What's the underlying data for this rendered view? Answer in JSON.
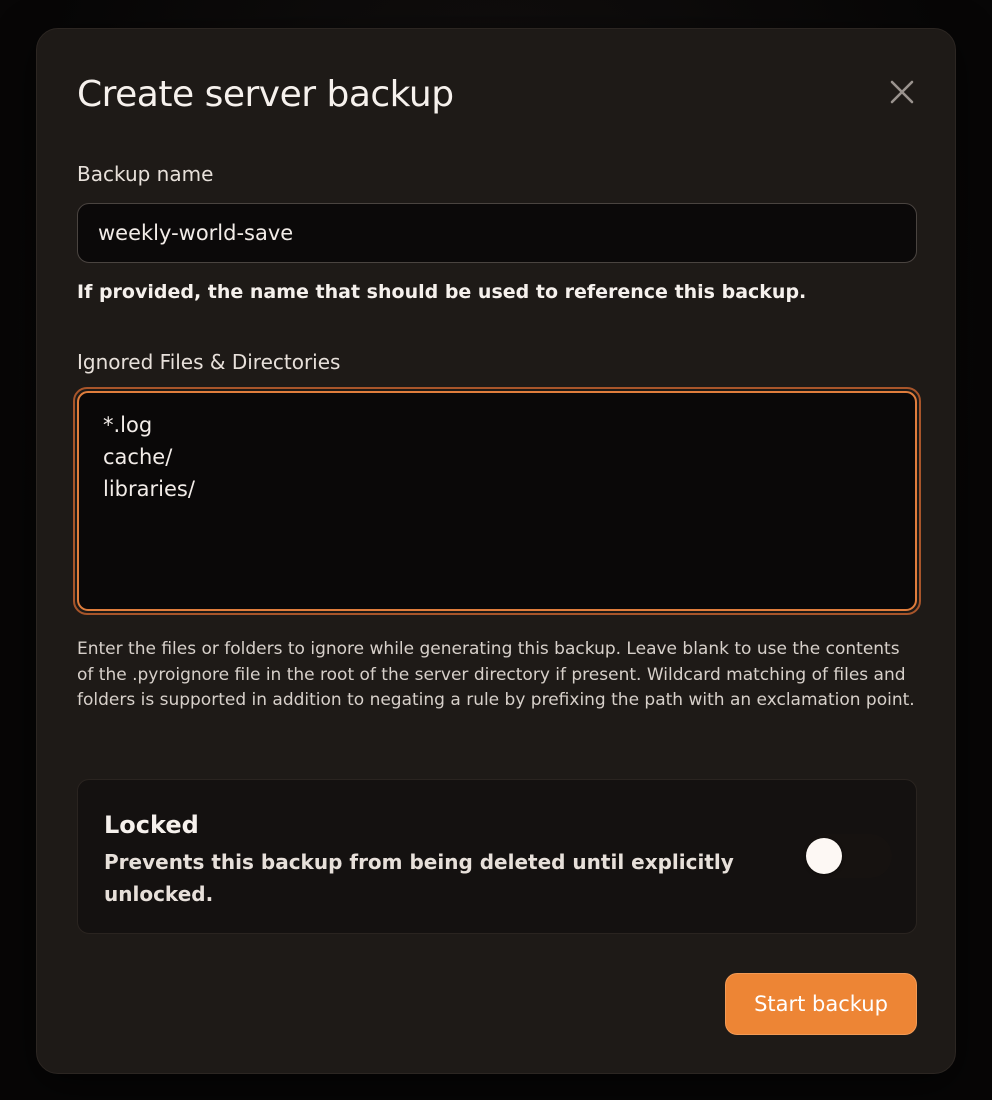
{
  "dialog": {
    "title": "Create server backup"
  },
  "name_field": {
    "label": "Backup name",
    "value": "weekly-world-save",
    "hint": "If provided, the name that should be used to reference this backup."
  },
  "ignored_field": {
    "label": "Ignored Files & Directories",
    "value": "*.log\ncache/\nlibraries/",
    "help": "Enter the files or folders to ignore while generating this backup. Leave blank to use the contents of the .pyroignore file in the root of the server directory if present. Wildcard matching of files and folders is supported in addition to negating a rule by prefixing the path with an exclamation point."
  },
  "lock_option": {
    "title": "Locked",
    "description": "Prevents this backup from being deleted until explicitly unlocked.",
    "enabled": false
  },
  "actions": {
    "submit_label": "Start backup"
  },
  "colors": {
    "accent": "#ed8535",
    "focus_ring": "#e07d3c",
    "modal_bg": "#1e1a17",
    "input_bg": "#0b0909"
  },
  "icons": {
    "close": "close-icon"
  }
}
